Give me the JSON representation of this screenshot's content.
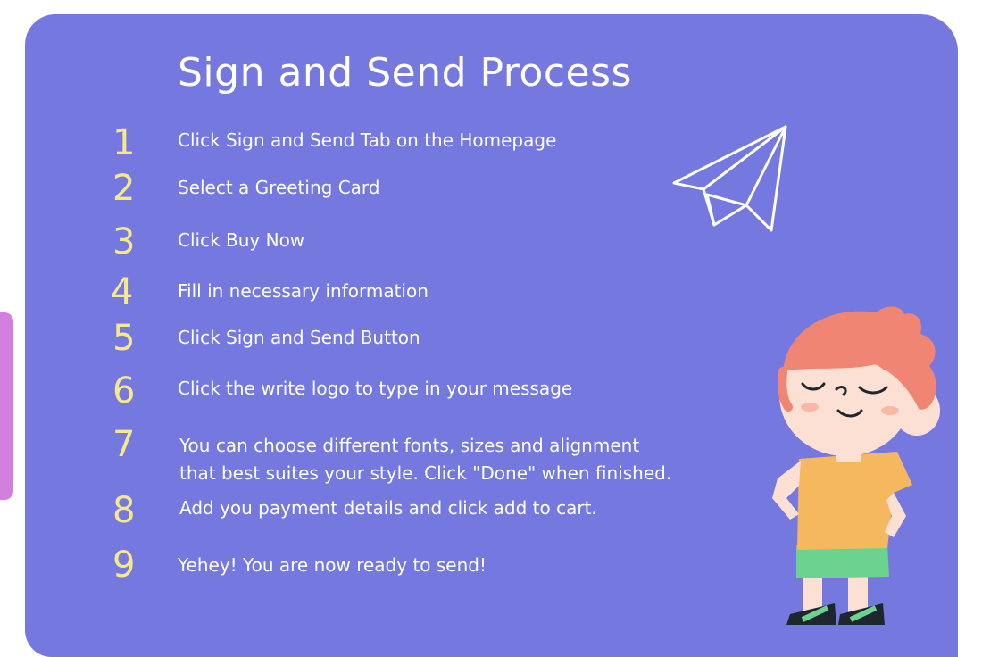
{
  "title": "Sign and Send Process",
  "steps": [
    {
      "number": "1",
      "text": "Click Sign and Send Tab on the Homepage"
    },
    {
      "number": "2",
      "text": "Select a Greeting Card"
    },
    {
      "number": "3",
      "text": "Click Buy Now"
    },
    {
      "number": "4",
      "text": "Fill in necessary information"
    },
    {
      "number": "5",
      "text": "Click Sign and Send Button"
    },
    {
      "number": "6",
      "text": "Click the write logo to type in your message"
    },
    {
      "number": "7",
      "text_lines": [
        "You can choose different fonts, sizes and alignment",
        "that best suites your style. Click \"Done\" when finished."
      ]
    },
    {
      "number": "8",
      "text": "Add you payment details and click add to cart."
    },
    {
      "number": "9",
      "text": "Yehey! You are now ready to send!"
    }
  ],
  "colors": {
    "panel": "#7579df",
    "step_number": "#f6e98a",
    "text": "#ffffff",
    "side_tab": "#d27fe0"
  },
  "illustrations": [
    "paper-plane-icon",
    "boy-illustration"
  ]
}
